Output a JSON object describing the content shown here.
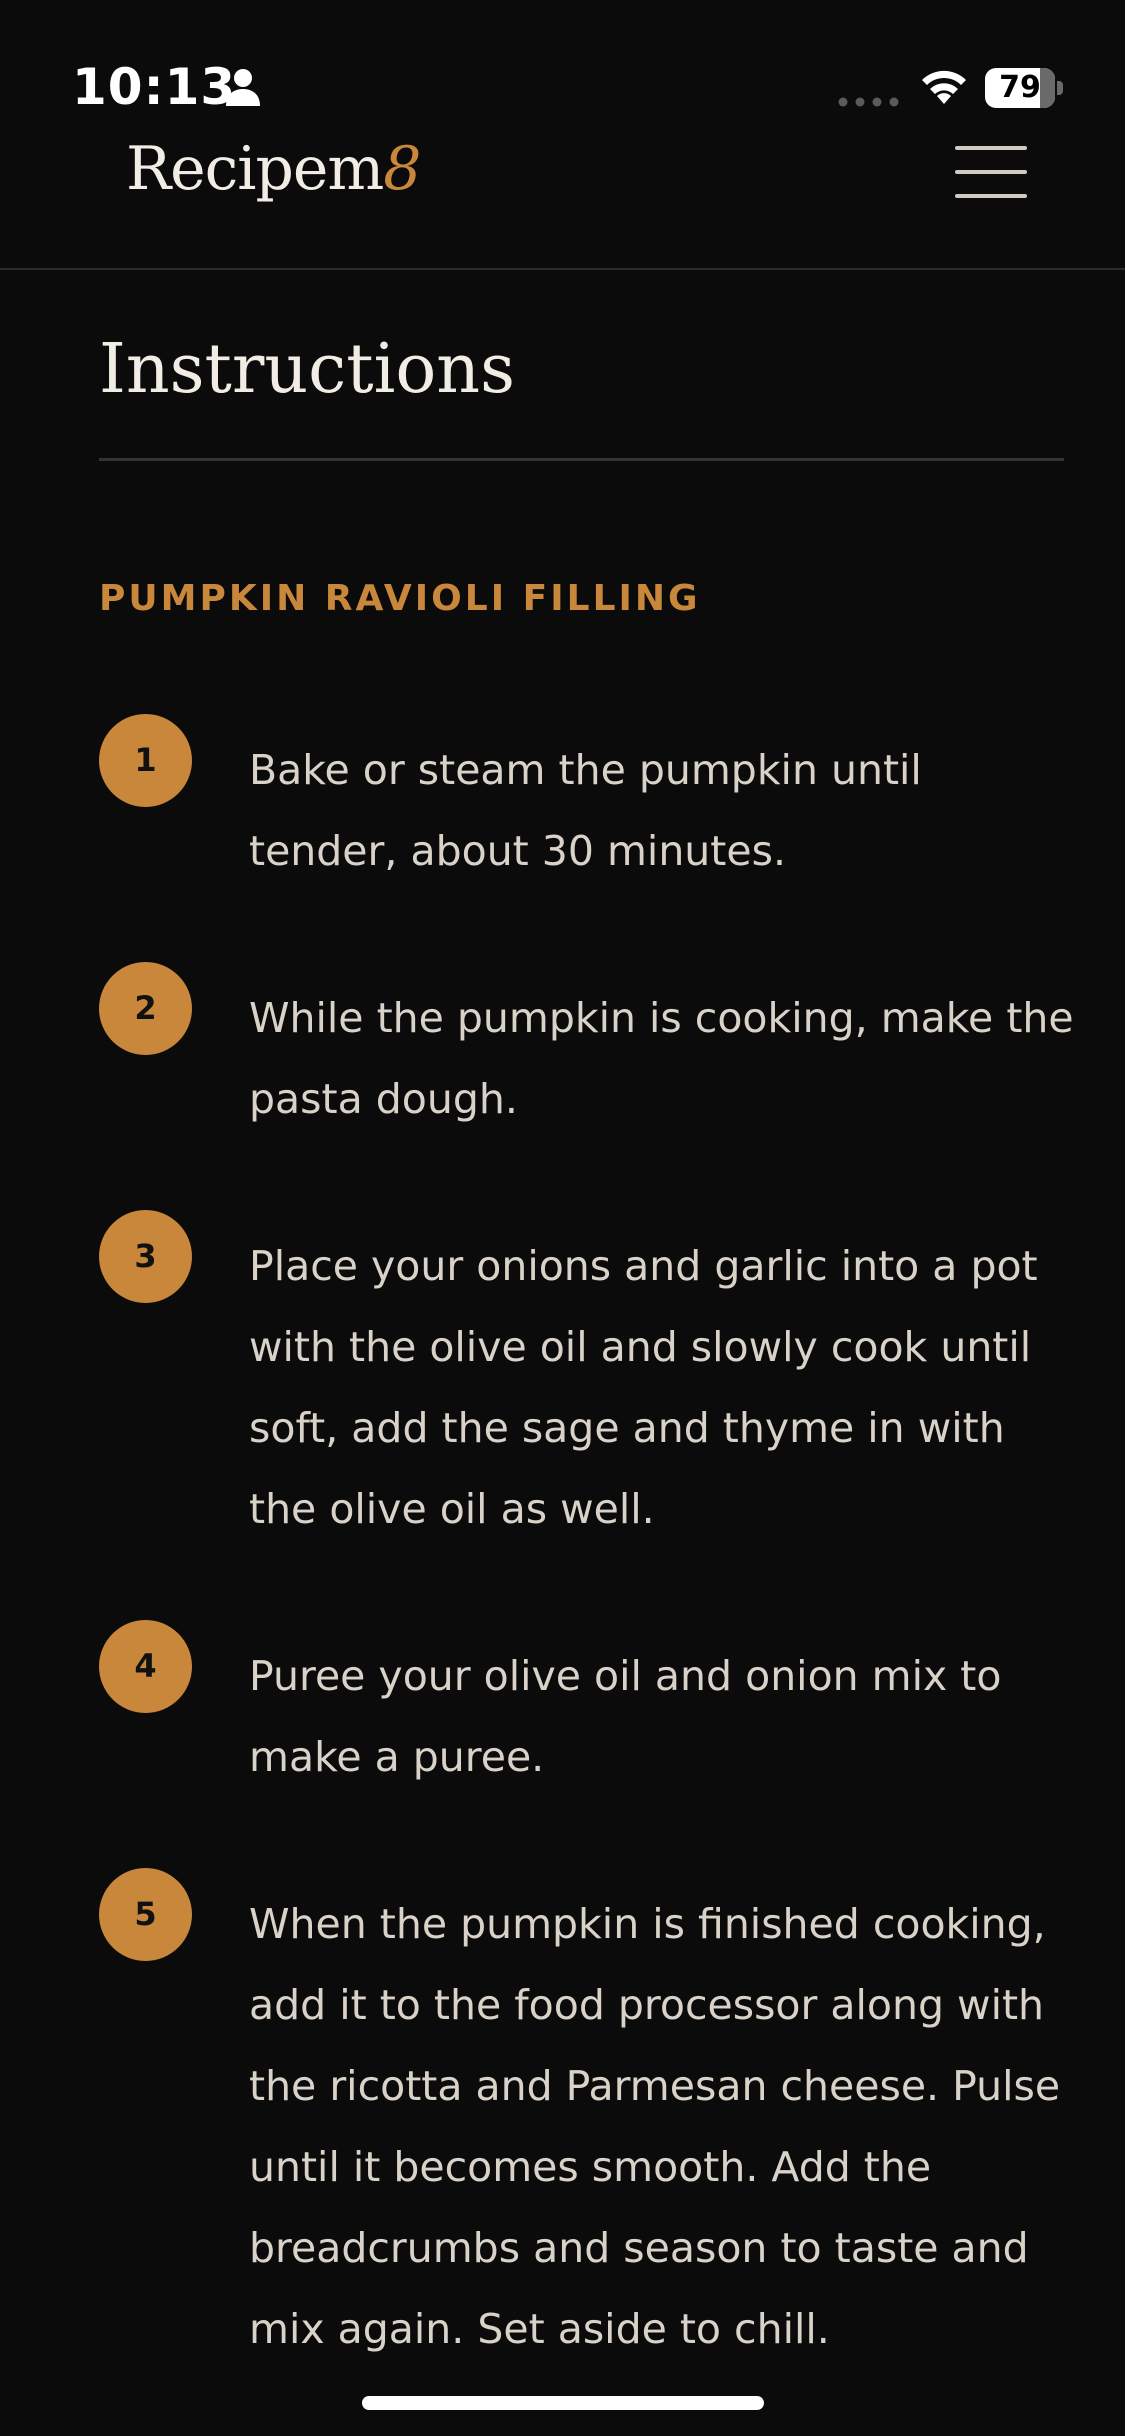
{
  "status_bar": {
    "time": "10:13",
    "battery": "79",
    "battery_level_percent": 79,
    "icons": [
      "person-icon",
      "signal-dots-icon",
      "wifi-icon",
      "battery-icon"
    ]
  },
  "header": {
    "logo_main": "Recipem",
    "logo_accent": "8",
    "accent_color": "#c8873a",
    "menu_icon": "hamburger-menu-icon"
  },
  "main": {
    "title": "Instructions",
    "group_heading": "PUMPKIN RAVIOLI FILLING",
    "steps": [
      {
        "number": "1",
        "text": "Bake or steam the pumpkin until tender, about 30 minutes."
      },
      {
        "number": "2",
        "text": "While the pumpkin is cooking, make the pasta dough."
      },
      {
        "number": "3",
        "text": "Place your onions and garlic into a pot with the olive oil and slowly cook until soft, add the sage and thyme in with the olive oil as well."
      },
      {
        "number": "4",
        "text": "Puree your olive oil and onion mix to make a puree."
      },
      {
        "number": "5",
        "text": "When the pumpkin is finished cooking, add it to the food processor along with the ricotta and Parmesan cheese. Pulse until it becomes smooth. Add the breadcrumbs and season to taste and mix again. Set aside to chill."
      }
    ]
  },
  "colors": {
    "background": "#0b0b0b",
    "accent": "#c8873a",
    "text": "#d8d2c8",
    "heading": "#f2ede4"
  }
}
